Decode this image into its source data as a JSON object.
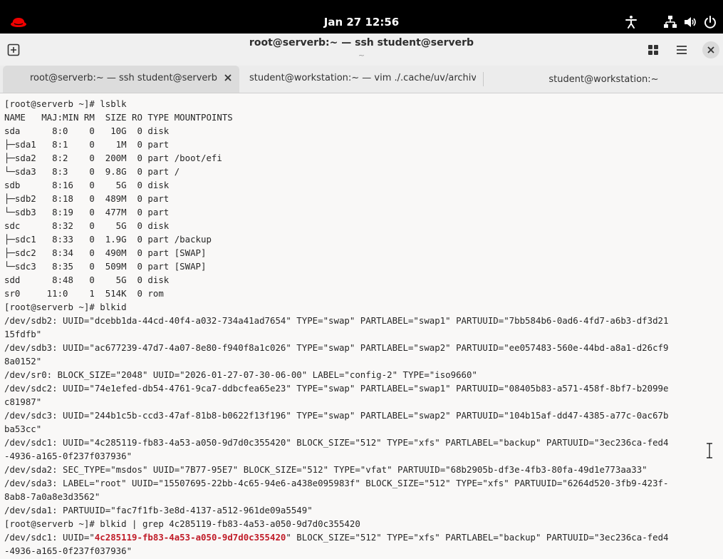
{
  "topbar": {
    "clock": "Jan 27  12:56",
    "logo_icon": "redhat-logo-icon",
    "indicators": [
      "accessibility-icon",
      "network-icon",
      "volume-icon",
      "power-icon"
    ]
  },
  "window": {
    "title": "root@serverb:~ — ssh student@serverb",
    "subtitle": "~",
    "new_tab_icon": "new-tab-icon",
    "tab_overview_icon": "tab-overview-icon",
    "menu_icon": "hamburger-menu-icon",
    "close_icon": "close-icon"
  },
  "tabs": [
    {
      "label": "root@serverb:~ — ssh student@serverb",
      "active": true
    },
    {
      "label": "student@workstation:~ — vim ./.cache/uv/archive",
      "active": false
    },
    {
      "label": "student@workstation:~",
      "active": false
    }
  ],
  "terminal": {
    "before_highlight": "[root@serverb ~]# lsblk\nNAME   MAJ:MIN RM  SIZE RO TYPE MOUNTPOINTS\nsda      8:0    0   10G  0 disk\n├─sda1   8:1    0    1M  0 part\n├─sda2   8:2    0  200M  0 part /boot/efi\n└─sda3   8:3    0  9.8G  0 part /\nsdb      8:16   0    5G  0 disk\n├─sdb2   8:18   0  489M  0 part\n└─sdb3   8:19   0  477M  0 part\nsdc      8:32   0    5G  0 disk\n├─sdc1   8:33   0  1.9G  0 part /backup\n├─sdc2   8:34   0  490M  0 part [SWAP]\n└─sdc3   8:35   0  509M  0 part [SWAP]\nsdd      8:48   0    5G  0 disk\nsr0     11:0    1  514K  0 rom\n[root@serverb ~]# blkid\n/dev/sdb2: UUID=\"dcebb1da-44cd-40f4-a032-734a41ad7654\" TYPE=\"swap\" PARTLABEL=\"swap1\" PARTUUID=\"7bb584b6-0ad6-4fd7-a6b3-df3d21\n15fdfb\"\n/dev/sdb3: UUID=\"ac677239-47d7-4a07-8e80-f940f8a1c026\" TYPE=\"swap\" PARTLABEL=\"swap2\" PARTUUID=\"ee057483-560e-44bd-a8a1-d26cf9\n8a0152\"\n/dev/sr0: BLOCK_SIZE=\"2048\" UUID=\"2026-01-27-07-30-06-00\" LABEL=\"config-2\" TYPE=\"iso9660\"\n/dev/sdc2: UUID=\"74e1efed-db54-4761-9ca7-ddbcfea65e23\" TYPE=\"swap\" PARTLABEL=\"swap1\" PARTUUID=\"08405b83-a571-458f-8bf7-b2099e\nc81987\"\n/dev/sdc3: UUID=\"244b1c5b-ccd3-47af-81b8-b0622f13f196\" TYPE=\"swap\" PARTLABEL=\"swap2\" PARTUUID=\"104b15af-dd47-4385-a77c-0ac67b\nba53cc\"\n/dev/sdc1: UUID=\"4c285119-fb83-4a53-a050-9d7d0c355420\" BLOCK_SIZE=\"512\" TYPE=\"xfs\" PARTLABEL=\"backup\" PARTUUID=\"3ec236ca-fed4\n-4936-a165-0f237f037936\"\n/dev/sda2: SEC_TYPE=\"msdos\" UUID=\"7B77-95E7\" BLOCK_SIZE=\"512\" TYPE=\"vfat\" PARTUUID=\"68b2905b-df3e-4fb3-80fa-49d1e773aa33\"\n/dev/sda3: LABEL=\"root\" UUID=\"15507695-22bb-4c65-94e6-a438e095983f\" BLOCK_SIZE=\"512\" TYPE=\"xfs\" PARTUUID=\"6264d520-3fb9-423f-\n8ab8-7a0a8e3d3562\"\n/dev/sda1: PARTUUID=\"fac7f1fb-3e8d-4137-a512-961de09a5549\"\n[root@serverb ~]# blkid | grep 4c285119-fb83-4a53-a050-9d7d0c355420\n/dev/sdc1: UUID=\"",
    "highlight": "4c285119-fb83-4a53-a050-9d7d0c355420",
    "after_highlight": "\" BLOCK_SIZE=\"512\" TYPE=\"xfs\" PARTLABEL=\"backup\" PARTUUID=\"3ec236ca-fed4\n-4936-a165-0f237f037936\"",
    "highlight_color": "#c01c28"
  },
  "colors": {
    "topbar_bg": "#000000",
    "titlebar_bg": "#f0f0f0",
    "terminal_bg": "#f9f8f7",
    "redhat_red": "#ee0000"
  }
}
